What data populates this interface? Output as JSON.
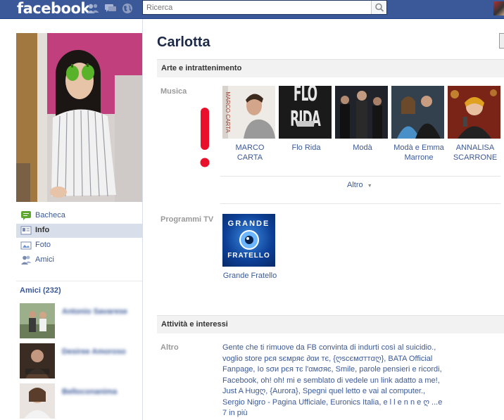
{
  "topbar": {
    "logo": "facebook",
    "search_placeholder": "Ricerca"
  },
  "profile": {
    "name": "Carlotta"
  },
  "left_nav": [
    {
      "label": "Bacheca",
      "icon": "wall-icon"
    },
    {
      "label": "Info",
      "icon": "info-icon",
      "active": true
    },
    {
      "label": "Foto",
      "icon": "photos-icon"
    },
    {
      "label": "Amici",
      "icon": "friends-icon"
    }
  ],
  "friends": {
    "heading": "Amici (232)",
    "items": [
      {
        "name": "Antonio Savarese"
      },
      {
        "name": "Desiree Amoroso"
      },
      {
        "name": "Belloconanima"
      }
    ]
  },
  "sections": {
    "arts": {
      "heading": "Arte e intrattenimento",
      "music_label": "Musica",
      "music": [
        {
          "label": "MARCO CARTA",
          "label2": ""
        },
        {
          "label": "Flo Rida",
          "label2": ""
        },
        {
          "label": "Modà",
          "label2": ""
        },
        {
          "label": "Modà e Emma",
          "label2": "Marrone"
        },
        {
          "label": "ANNALISA",
          "label2": "SCARRONE"
        }
      ],
      "more": "Altro",
      "tv_label": "Programmi TV",
      "tv": [
        {
          "label": "Grande Fratello",
          "logo_line1": "GRANDE",
          "logo_line2": "FRATELLO"
        }
      ],
      "flo_rida_art": "FLO RIDA",
      "marco_carta_art": "MARCO CARTA"
    },
    "activities": {
      "heading": "Attività e interessi",
      "label": "Altro",
      "lines": [
        "Gente che ti rimuove da FB convinta di indurti così al suicidio.,",
        "vоgliо stоre pєя sємpяє ∂αи тє, {ღscємσттαღ}, BATA Official",
        "Fanpage, Io sσи pєя тє l'αмσяє, Smile, parole pensieri e ricordi,",
        "Facebook, oh! oh! mi e semblato di vedele un link adatto a me!,",
        "Just A Hugღ, {Aurora}, Spegni quel letto e vai al computer.,",
        "Sergio Nigro - Pagina Ufficiale, Euronics Italia, e l l e n n e ღ ...e",
        "7 in più"
      ]
    }
  },
  "colors": {
    "brand": "#3b5998",
    "link": "#3b5998",
    "section_bg": "#f2f2f2"
  }
}
